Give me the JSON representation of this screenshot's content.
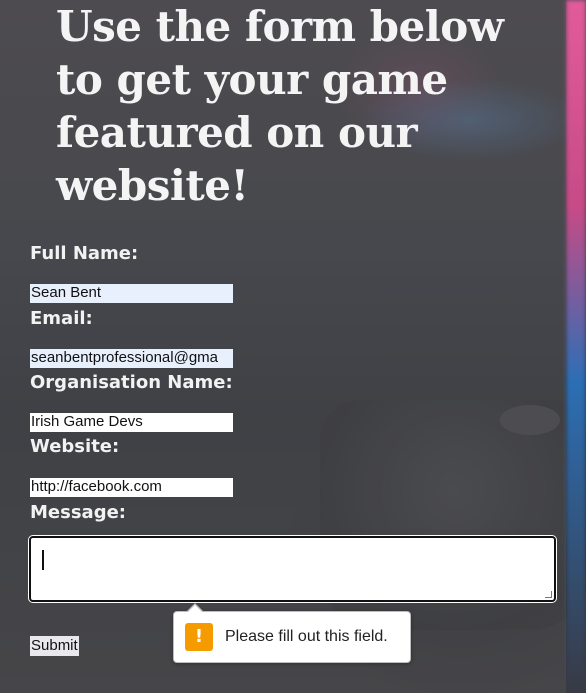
{
  "heading": "Use the form below to get your game featured on our website!",
  "form": {
    "full_name_label": "Full Name:",
    "full_name_value": "Sean Bent",
    "email_label": "Email:",
    "email_value": "seanbentprofessional@gma",
    "org_label": "Organisation Name:",
    "org_value": "Irish Game Devs",
    "website_label": "Website:",
    "website_value": "http://facebook.com",
    "message_label": "Message:",
    "message_value": "",
    "submit_label": "Submit"
  },
  "validation": {
    "message": "Please fill out this field.",
    "icon": "warning-icon",
    "icon_glyph": "!",
    "icon_color": "#f59b00"
  }
}
